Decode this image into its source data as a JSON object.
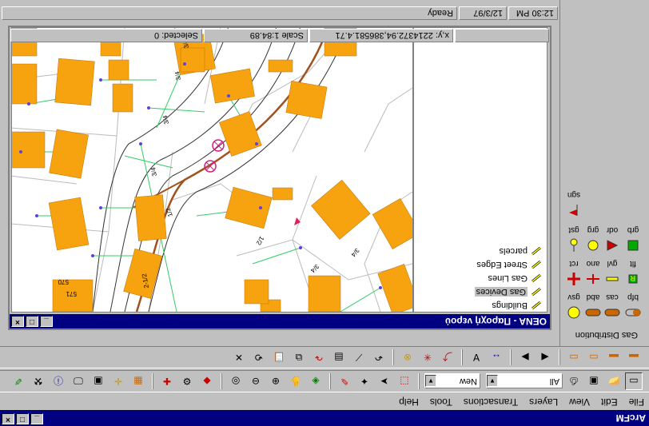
{
  "app": {
    "title": "ArcFM"
  },
  "menu": [
    "File",
    "Edit",
    "View",
    "Layers",
    "Transactions",
    "Tools",
    "Help"
  ],
  "toolbar_main": {
    "combo_all": "All",
    "combo_new": "New"
  },
  "gas_panel": {
    "title": "Gas Distribution",
    "rows": [
      [
        "bfp",
        "cas",
        "abd",
        "gsv"
      ],
      [
        "flt",
        "gvl",
        "ano",
        "rct"
      ],
      [
        "grb",
        "odr",
        "grg",
        "gst"
      ],
      [
        "sgn"
      ]
    ]
  },
  "doc": {
    "title": "OENA - Παροχή νερού",
    "layers": [
      {
        "label": "Buildings",
        "selected": false
      },
      {
        "label": "Gas Devices",
        "selected": true
      },
      {
        "label": "Gas Lines",
        "selected": false
      },
      {
        "label": "Street Edges",
        "selected": false
      },
      {
        "label": "parcels",
        "selected": false
      }
    ],
    "status": {
      "selected": "Selected: 0",
      "scale": "Scale 1:84.89",
      "coords": "x,y: 2214372.94,386581.4.71"
    }
  },
  "map": {
    "labels": [
      "570",
      "571",
      "2-1/2",
      "3/4",
      "1/2",
      "1/2",
      "3/4",
      "3/4",
      "3/4",
      "3/4",
      "3/4"
    ]
  },
  "app_status": {
    "message": "Ready",
    "date": "12/3/97",
    "time": "12:30 PM"
  },
  "colors": {
    "titlebar": "#000080",
    "building": "#f7a20f",
    "main_line": "#a0521e",
    "service_line": "#33cc66"
  }
}
